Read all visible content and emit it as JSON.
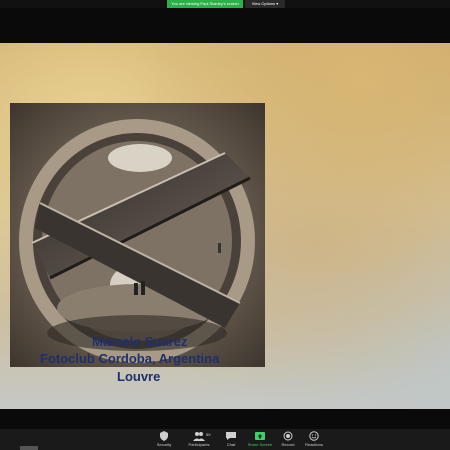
{
  "banner": {
    "sharing_text": "You are viewing Paul Stanley's screen",
    "view_options_label": "View Options ▾"
  },
  "slide": {
    "caption_name": "Marcelo Suarez",
    "caption_club": "Fotoclub Cordoba, Argentina",
    "caption_title": "Louvre"
  },
  "toolbar": {
    "items": [
      {
        "label": "Security",
        "icon": "shield-icon"
      },
      {
        "label": "Participants",
        "icon": "participants-icon",
        "count": "59"
      },
      {
        "label": "Chat",
        "icon": "chat-icon"
      },
      {
        "label": "Share Screen",
        "icon": "share-screen-icon"
      },
      {
        "label": "Record",
        "icon": "record-icon"
      },
      {
        "label": "Reactions",
        "icon": "reactions-icon"
      }
    ]
  },
  "colors": {
    "share_green": "#2bb14a",
    "caption_blue": "#1d2f6e",
    "toolbar_bg": "#1a1a1a"
  }
}
